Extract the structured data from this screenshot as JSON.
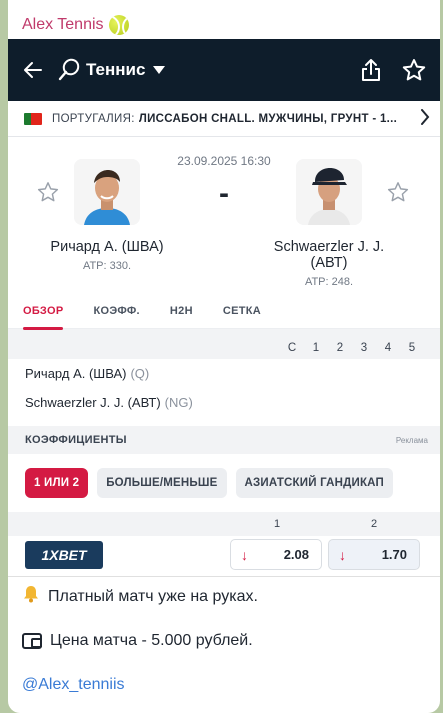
{
  "chat": {
    "sender": "Alex Tennis",
    "sender_icon": "tennis-ball-icon"
  },
  "app": {
    "sport": "Теннис",
    "league_country": "ПОРТУГАЛИЯ:",
    "league_name": "ЛИССАБОН CHALL. МУЖЧИНЫ, ГРУНТ - 1...",
    "datetime": "23.09.2025 16:30",
    "score_separator": "-",
    "player1": {
      "name": "Ричард А. (ШВА)",
      "rank": "ATP: 330."
    },
    "player2": {
      "name": "Schwaerzler J. J. (AВТ)",
      "rank": "ATP: 248."
    },
    "tabs": [
      "ОБЗОР",
      "КОЭФФ.",
      "H2H",
      "СЕТКА"
    ],
    "active_tab": "ОБЗОР",
    "score_header": [
      "С",
      "1",
      "2",
      "3",
      "4",
      "5"
    ],
    "score_rows": [
      {
        "name": "Ричард А. (ШВА)",
        "tag": "(Q)"
      },
      {
        "name": "Schwaerzler J. J. (AВТ)",
        "tag": "(NG)"
      }
    ],
    "odds_section_title": "КОЭФФИЦИЕНТЫ",
    "ad_label": "Реклама",
    "bet_types": [
      "1 ИЛИ 2",
      "БОЛЬШЕ/МЕНЬШЕ",
      "АЗИАТСКИЙ ГАНДИКАП"
    ],
    "active_bet_type": "1 ИЛИ 2",
    "odds_header": [
      "1",
      "2"
    ],
    "bookmaker": {
      "name_part1": "1X",
      "name_part2": "BET"
    },
    "odds": [
      {
        "value": "2.08",
        "trend": "down"
      },
      {
        "value": "1.70",
        "trend": "down"
      }
    ]
  },
  "message": {
    "line1": "Платный матч уже на руках.",
    "line2": "Цена матча - 5.000 рублей.",
    "link": "@Alex_tenniis"
  },
  "colors": {
    "accent": "#d41a43",
    "topbar": "#0e1d2b",
    "sender": "#c03a6b",
    "link": "#3a7bd5"
  }
}
